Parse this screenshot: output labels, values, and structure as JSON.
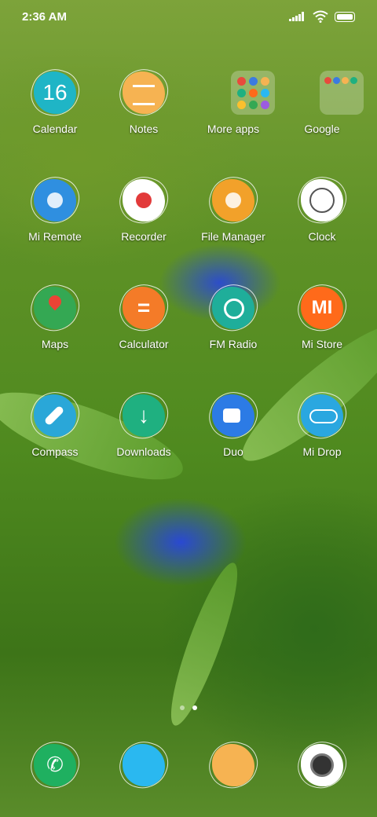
{
  "status_bar": {
    "time": "2:36 AM"
  },
  "apps": [
    {
      "label": "Calendar",
      "icon": "calendar-icon",
      "color": "#1fb5c6",
      "glyph": "16"
    },
    {
      "label": "Notes",
      "icon": "notes-icon",
      "color": "#f6b352",
      "glyph": ""
    },
    {
      "label": "More apps",
      "icon": "folder-icon",
      "color": "#ffffff",
      "glyph": ""
    },
    {
      "label": "Google",
      "icon": "folder-icon",
      "color": "#ffffff",
      "glyph": ""
    },
    {
      "label": "Mi Remote",
      "icon": "remote-icon",
      "color": "#2f8fe0",
      "glyph": ""
    },
    {
      "label": "Recorder",
      "icon": "recorder-icon",
      "color": "#ffffff",
      "glyph": ""
    },
    {
      "label": "File Manager",
      "icon": "folder-icon",
      "color": "#f2a12a",
      "glyph": ""
    },
    {
      "label": "Clock",
      "icon": "clock-icon",
      "color": "#ffffff",
      "glyph": ""
    },
    {
      "label": "Maps",
      "icon": "map-pin-icon",
      "color": "#34a853",
      "glyph": ""
    },
    {
      "label": "Calculator",
      "icon": "calculator-icon",
      "color": "#f47b28",
      "glyph": "="
    },
    {
      "label": "FM Radio",
      "icon": "radio-icon",
      "color": "#1fae9a",
      "glyph": ""
    },
    {
      "label": "Mi Store",
      "icon": "mi-store-icon",
      "color": "#ff6a1a",
      "glyph": "MI"
    },
    {
      "label": "Compass",
      "icon": "compass-icon",
      "color": "#2aa7d8",
      "glyph": ""
    },
    {
      "label": "Downloads",
      "icon": "download-icon",
      "color": "#1fb080",
      "glyph": "↓"
    },
    {
      "label": "Duo",
      "icon": "video-icon",
      "color": "#2c7be5",
      "glyph": ""
    },
    {
      "label": "Mi Drop",
      "icon": "mi-drop-icon",
      "color": "#2aa7e0",
      "glyph": ""
    }
  ],
  "dock": [
    {
      "icon": "phone-icon",
      "color": "#1fb060"
    },
    {
      "icon": "messages-icon",
      "color": "#2ab8f0"
    },
    {
      "icon": "browser-icon",
      "color": "#f6b352"
    },
    {
      "icon": "camera-icon",
      "color": "#ffffff"
    }
  ]
}
